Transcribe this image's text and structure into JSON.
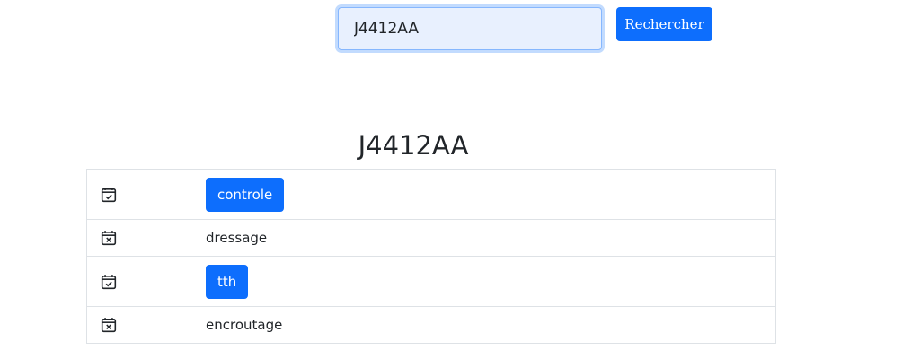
{
  "search": {
    "value": "J4412AA",
    "button_label": "Rechercher"
  },
  "result": {
    "title": "J4412AA",
    "steps": [
      {
        "name": "controle",
        "status": "done",
        "icon": "calendar-check-icon"
      },
      {
        "name": "dressage",
        "status": "not-done",
        "icon": "calendar-x-icon"
      },
      {
        "name": "tth",
        "status": "done",
        "icon": "calendar-check-icon"
      },
      {
        "name": "encroutage",
        "status": "not-done",
        "icon": "calendar-x-icon"
      }
    ]
  },
  "colors": {
    "accent": "#0d6efd",
    "input_background": "#e8f0fe",
    "border": "#dee2e6"
  }
}
